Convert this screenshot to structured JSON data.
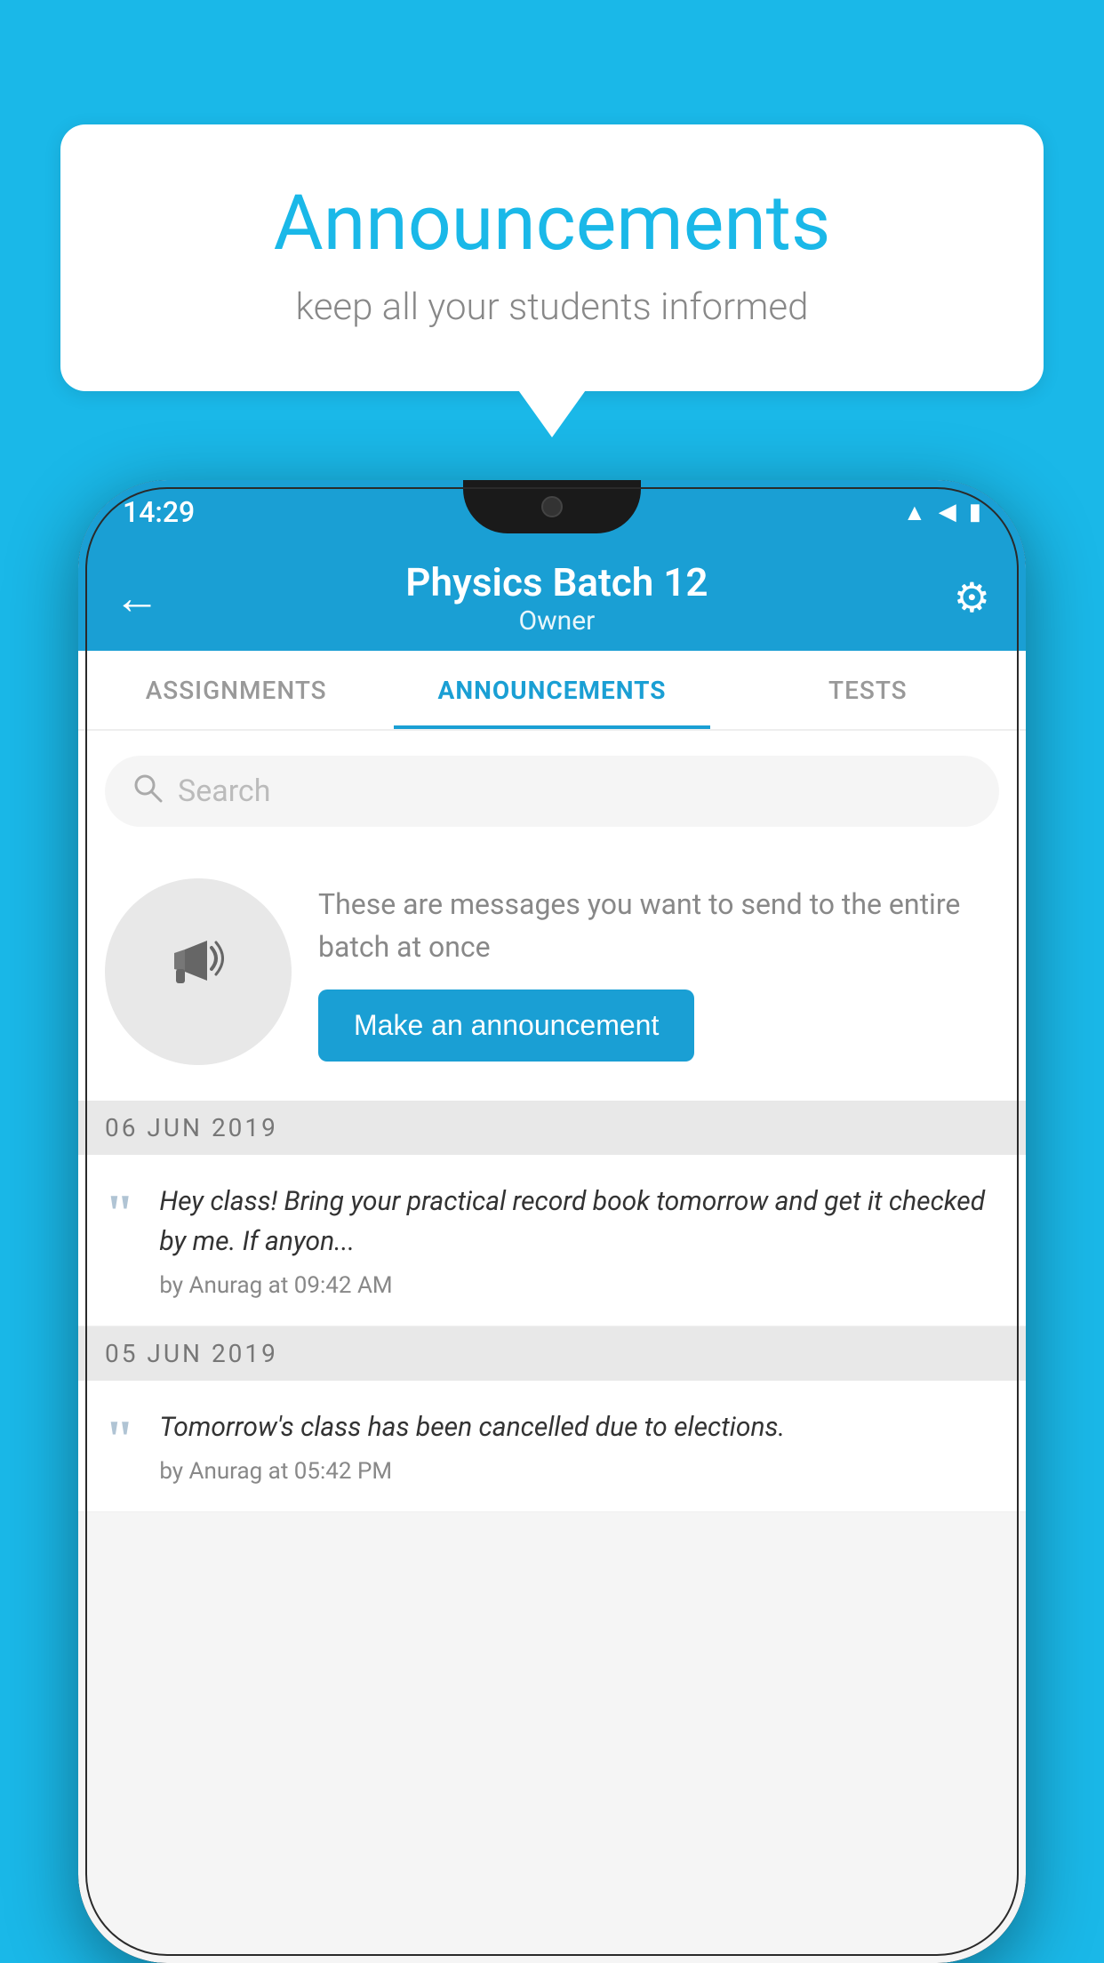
{
  "background_color": "#1ab8e8",
  "speech_bubble": {
    "title": "Announcements",
    "subtitle": "keep all your students informed"
  },
  "phone": {
    "status_bar": {
      "time": "14:29",
      "icons": [
        "wifi",
        "signal",
        "battery"
      ]
    },
    "app_bar": {
      "title": "Physics Batch 12",
      "subtitle": "Owner",
      "back_label": "←",
      "settings_label": "⚙"
    },
    "tabs": [
      {
        "label": "ASSIGNMENTS",
        "active": false
      },
      {
        "label": "ANNOUNCEMENTS",
        "active": true
      },
      {
        "label": "TESTS",
        "active": false
      }
    ],
    "search": {
      "placeholder": "Search"
    },
    "promo": {
      "description": "These are messages you want to send to the entire batch at once",
      "button_label": "Make an announcement"
    },
    "announcements": [
      {
        "date": "06  JUN  2019",
        "message": "Hey class! Bring your practical record book tomorrow and get it checked by me. If anyon...",
        "meta": "by Anurag at 09:42 AM"
      },
      {
        "date": "05  JUN  2019",
        "message": "Tomorrow's class has been cancelled due to elections.",
        "meta": "by Anurag at 05:42 PM"
      }
    ]
  }
}
